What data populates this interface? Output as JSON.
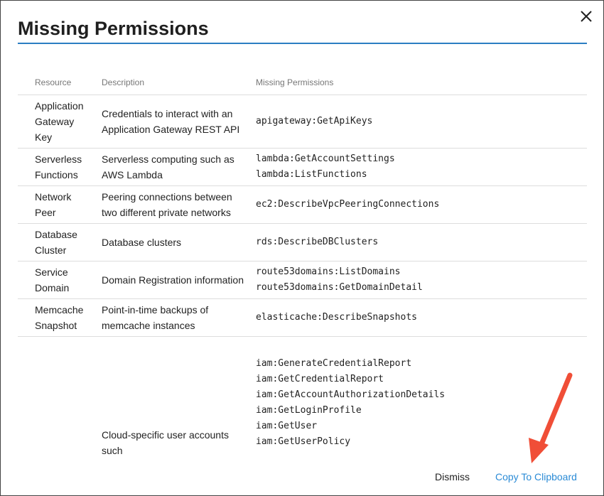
{
  "dialog": {
    "title": "Missing Permissions",
    "close_icon": "close-icon",
    "accent_color": "#2b7ec2"
  },
  "table": {
    "headers": [
      "Resource",
      "Description",
      "Missing Permissions"
    ],
    "rows": [
      {
        "resource": "Application Gateway Key",
        "description": "Credentials to interact with an Application Gateway REST API",
        "permissions": [
          "apigateway:GetApiKeys"
        ]
      },
      {
        "resource": "Serverless Functions",
        "description": "Serverless computing such as AWS Lambda",
        "permissions": [
          "lambda:GetAccountSettings",
          "lambda:ListFunctions"
        ]
      },
      {
        "resource": "Network Peer",
        "description": "Peering connections between two different private networks",
        "permissions": [
          "ec2:DescribeVpcPeeringConnections"
        ]
      },
      {
        "resource": "Database Cluster",
        "description": "Database clusters",
        "permissions": [
          "rds:DescribeDBClusters"
        ]
      },
      {
        "resource": "Service Domain",
        "description": "Domain Registration information",
        "permissions": [
          "route53domains:ListDomains",
          "route53domains:GetDomainDetail"
        ]
      },
      {
        "resource": "Memcache Snapshot",
        "description": "Point-in-time backups of memcache instances",
        "permissions": [
          "elasticache:DescribeSnapshots"
        ]
      },
      {
        "resource": "",
        "description": "Cloud-specific user accounts such",
        "permissions": [
          "iam:GenerateCredentialReport",
          "iam:GetCredentialReport",
          "iam:GetAccountAuthorizationDetails",
          "iam:GetLoginProfile",
          "iam:GetUser",
          "iam:GetUserPolicy"
        ]
      }
    ]
  },
  "footer": {
    "dismiss_label": "Dismiss",
    "copy_label": "Copy To Clipboard",
    "link_color": "#2b8bd6"
  },
  "annotation": {
    "arrow_icon": "red-arrow-icon",
    "arrow_color": "#f04e37"
  }
}
